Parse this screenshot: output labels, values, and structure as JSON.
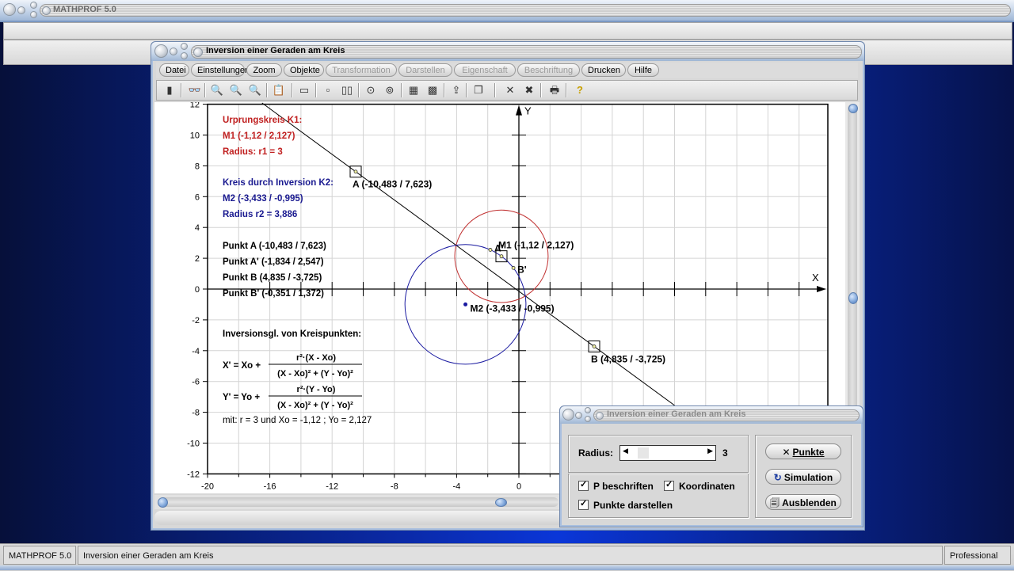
{
  "app": {
    "title": "MATHPROF 5.0"
  },
  "window": {
    "title": "Inversion einer Geraden am Kreis",
    "menu": [
      {
        "label": "Datei",
        "enabled": true
      },
      {
        "label": "Einstellungen",
        "enabled": true
      },
      {
        "label": "Zoom",
        "enabled": true
      },
      {
        "label": "Objekte",
        "enabled": true
      },
      {
        "label": "Transformation",
        "enabled": false
      },
      {
        "label": "Darstellen",
        "enabled": false
      },
      {
        "label": "Eigenschaft",
        "enabled": false
      },
      {
        "label": "Beschriftung",
        "enabled": false
      },
      {
        "label": "Drucken",
        "enabled": true
      },
      {
        "label": "Hilfe",
        "enabled": true
      }
    ],
    "toolbar": [
      {
        "icon": "window-icon",
        "glyph": "▮"
      },
      {
        "icon": "glasses-icon",
        "glyph": "👓"
      },
      {
        "icon": "zoom-out-icon",
        "glyph": "🔍"
      },
      {
        "icon": "zoom-reset-icon",
        "glyph": "🔍"
      },
      {
        "icon": "zoom-in-icon",
        "glyph": "🔍"
      },
      {
        "icon": "clipboard-icon",
        "glyph": "📋"
      },
      {
        "icon": "panel-icon",
        "glyph": "▭"
      },
      {
        "icon": "single-frame-icon",
        "glyph": "▫"
      },
      {
        "icon": "double-frame-icon",
        "glyph": "▯▯"
      },
      {
        "icon": "circle-button-1-icon",
        "glyph": "⊙"
      },
      {
        "icon": "circle-button-2-icon",
        "glyph": "⊚"
      },
      {
        "icon": "table-icon",
        "glyph": "▦"
      },
      {
        "icon": "image-export-icon",
        "glyph": "▩"
      },
      {
        "icon": "page-arrow-icon",
        "glyph": "⇪"
      },
      {
        "icon": "pages-icon",
        "glyph": "❐"
      },
      {
        "icon": "cross-1-icon",
        "glyph": "✕"
      },
      {
        "icon": "cross-2-icon",
        "glyph": "✖"
      },
      {
        "icon": "printer-icon",
        "glyph": "🖶"
      },
      {
        "icon": "help-icon",
        "glyph": "?"
      }
    ]
  },
  "chart_data": {
    "type": "scatter",
    "title": "Inversion einer Geraden am Kreis",
    "xlabel": "X",
    "ylabel": "Y",
    "xlim": [
      -20,
      24
    ],
    "ylim": [
      -12,
      12
    ],
    "x_ticks": [
      -20,
      -16,
      -12,
      -8,
      -4,
      0
    ],
    "y_ticks": [
      12,
      10,
      8,
      6,
      4,
      2,
      0,
      -2,
      -4,
      -6,
      -8,
      -10,
      -12
    ],
    "grid": true,
    "circles": [
      {
        "name": "K1",
        "center": [
          -1.12,
          2.127
        ],
        "radius": 3,
        "color": "#c03030"
      },
      {
        "name": "K2",
        "center": [
          -3.433,
          -0.995
        ],
        "radius": 3.886,
        "color": "#1a1aa0"
      }
    ],
    "line": {
      "through": [
        [
          -10.483,
          7.623
        ],
        [
          4.835,
          -3.725
        ]
      ],
      "color": "#000000"
    },
    "points": [
      {
        "name": "A",
        "x": -10.483,
        "y": 7.623,
        "label": "A (-10,483 / 7,623)",
        "boxed": true
      },
      {
        "name": "B",
        "x": 4.835,
        "y": -3.725,
        "label": "B (4,835 / -3,725)",
        "boxed": true
      },
      {
        "name": "M1",
        "x": -1.12,
        "y": 2.127,
        "label": "M1 (-1,12 / 2,127)",
        "boxed": true
      },
      {
        "name": "A'",
        "x": -1.834,
        "y": 2.547,
        "label": "A'",
        "boxed": false
      },
      {
        "name": "B'",
        "x": -0.351,
        "y": 1.372,
        "label": "B'",
        "boxed": false
      },
      {
        "name": "M2",
        "x": -3.433,
        "y": -0.995,
        "label": "M2 (-3,433 / -0,995)",
        "boxed": false
      }
    ],
    "annotations": {
      "red": [
        "Urprungskreis K1:",
        "M1 (-1,12 / 2,127)",
        "Radius: r1 = 3"
      ],
      "blue": [
        "Kreis durch Inversion K2:",
        "M2 (-3,433 / -0,995)",
        "Radius r2 = 3,886"
      ],
      "black": [
        "Punkt A (-10,483 / 7,623)",
        "Punkt A' (-1,834 / 2,547)",
        "Punkt B (4,835 / -3,725)",
        "Punkt B' (-0,351 / 1,372)"
      ],
      "equations_title": "Inversionsgl. von Kreispunkten:",
      "eq_x_lhs": "X' = Xo +",
      "eq_x_num": "r²·(X - Xo)",
      "eq_y_lhs": "Y' = Yo +",
      "eq_y_num": "r²·(Y - Yo)",
      "eq_den": "(X - Xo)² + (Y - Yo)²",
      "params": "mit: r = 3 und  Xo = -1,12 ;  Yo = 2,127"
    }
  },
  "dialog": {
    "title": "Inversion einer Geraden am Kreis",
    "radius_label": "Radius:",
    "radius_value": "3",
    "radius_slider_fraction": 0.1,
    "checkboxes": [
      {
        "label": "P beschriften",
        "checked": true
      },
      {
        "label": "Koordinaten",
        "checked": true
      },
      {
        "label": "Punkte darstellen",
        "checked": true
      }
    ],
    "buttons": [
      {
        "label": "Punkte",
        "icon": "cross-icon",
        "glyph": "✕"
      },
      {
        "label": "Simulation",
        "icon": "refresh-icon",
        "glyph": "↻"
      },
      {
        "label": "Ausblenden",
        "icon": "hide-icon",
        "glyph": "🗐"
      }
    ]
  },
  "statusbar": {
    "app": "MATHPROF 5.0",
    "document": "Inversion einer Geraden am Kreis",
    "edition": "Professional"
  }
}
